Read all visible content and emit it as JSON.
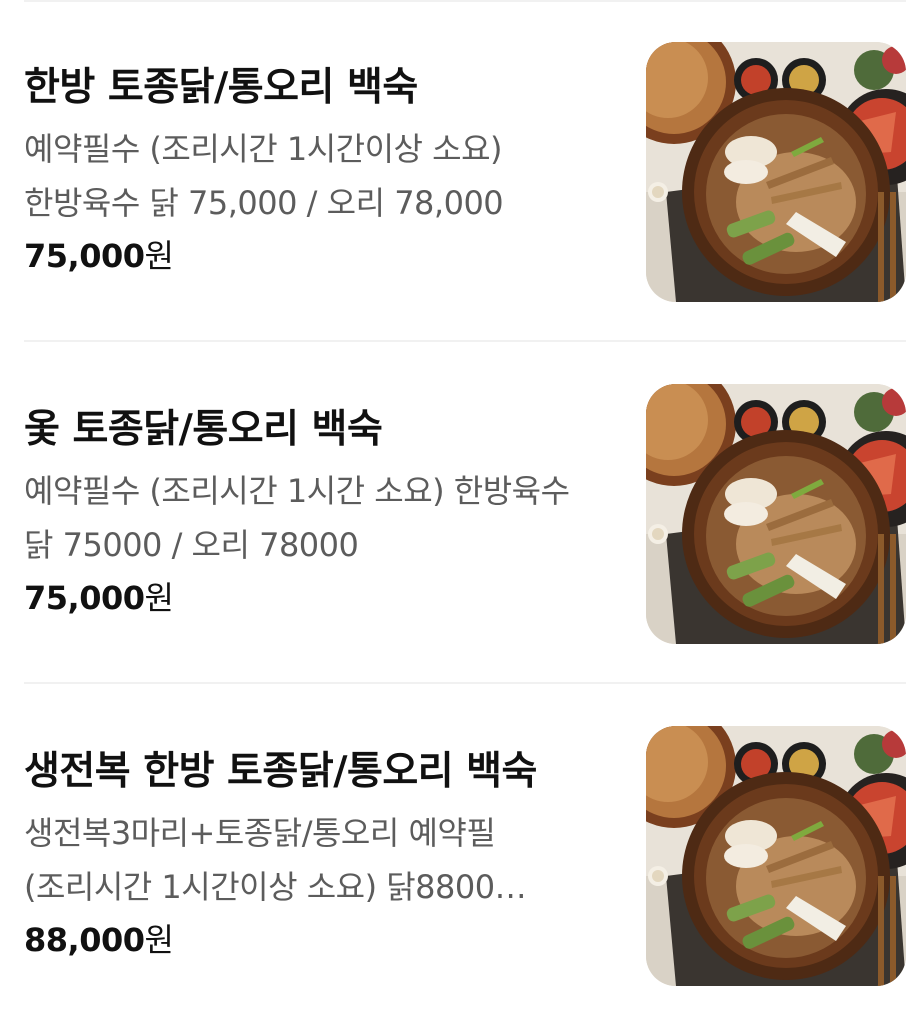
{
  "menu": {
    "items": [
      {
        "name": "한방 토종닭/통오리 백숙",
        "description": "예약필수 (조리시간 1시간이상 소요) 한방육수 닭 75,000 / 오리 78,000",
        "price_amount": "75,000",
        "price_unit": "원",
        "image_icon": "baeksuk-dish-photo"
      },
      {
        "name": "옻 토종닭/통오리 백숙",
        "description": "예약필수 (조리시간 1시간 소요) 한방육수 닭 75000 / 오리 78000",
        "price_amount": "75,000",
        "price_unit": "원",
        "image_icon": "baeksuk-dish-photo"
      },
      {
        "name": "생전복 한방 토종닭/통오리 백숙",
        "description": "생전복3마리+토종닭/통오리 예약필 (조리시간 1시간이상 소요) 닭8800…",
        "price_amount": "88,000",
        "price_unit": "원",
        "image_icon": "baeksuk-dish-photo"
      }
    ]
  },
  "colors": {
    "title_text": "#111111",
    "description_text": "#5c5c5c",
    "divider": "#f1f1f1",
    "background": "#ffffff"
  }
}
